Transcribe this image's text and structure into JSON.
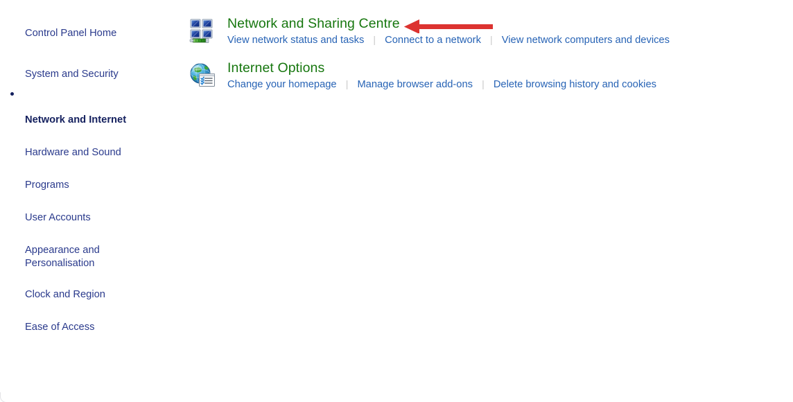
{
  "sidebar": {
    "items": [
      {
        "label": "Control Panel Home",
        "selected": false,
        "name": "sidebar-item-control-panel-home"
      },
      {
        "label": "System and Security",
        "selected": false,
        "name": "sidebar-item-system-and-security"
      },
      {
        "label": "Network and Internet",
        "selected": true,
        "name": "sidebar-item-network-and-internet"
      },
      {
        "label": "Hardware and Sound",
        "selected": false,
        "name": "sidebar-item-hardware-and-sound"
      },
      {
        "label": "Programs",
        "selected": false,
        "name": "sidebar-item-programs"
      },
      {
        "label": "User Accounts",
        "selected": false,
        "name": "sidebar-item-user-accounts"
      },
      {
        "label": "Appearance and\nPersonalisation",
        "selected": false,
        "name": "sidebar-item-appearance-and-personalisation"
      },
      {
        "label": "Clock and Region",
        "selected": false,
        "name": "sidebar-item-clock-and-region"
      },
      {
        "label": "Ease of Access",
        "selected": false,
        "name": "sidebar-item-ease-of-access"
      }
    ]
  },
  "main": {
    "categories": [
      {
        "title": "Network and Sharing Centre",
        "icon": "network-sharing-centre-icon",
        "links": [
          "View network status and tasks",
          "Connect to a network",
          "View network computers and devices"
        ]
      },
      {
        "title": "Internet Options",
        "icon": "internet-options-globe-icon",
        "links": [
          "Change your homepage",
          "Manage browser add-ons",
          "Delete browsing history and cookies"
        ]
      }
    ]
  },
  "annotation": {
    "type": "arrow",
    "direction": "left",
    "color": "#dc3330",
    "points_to": "Network and Sharing Centre"
  },
  "colors": {
    "heading_green": "#17770f",
    "link_blue": "#2763b5",
    "sidebar_blue": "#2a3a8c",
    "sidebar_selected": "#14205e",
    "separator_gray": "#c9c9c9",
    "background": "#ffffff"
  }
}
